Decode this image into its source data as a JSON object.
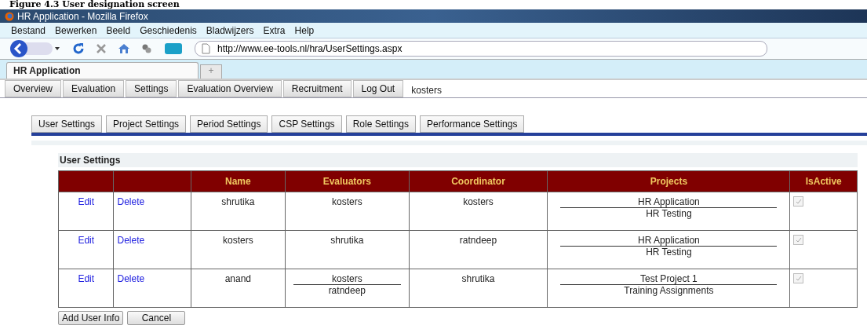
{
  "caption": "Figure 4.3 User designation screen",
  "window": {
    "title": "HR Application - Mozilla Firefox"
  },
  "menu": [
    "Bestand",
    "Bewerken",
    "Beeld",
    "Geschiedenis",
    "Bladwijzers",
    "Extra",
    "Help"
  ],
  "address": "http://www.ee-tools.nl/hra/UserSettings.aspx",
  "browser_tabs": [
    {
      "label": "HR Application",
      "selected": true
    }
  ],
  "new_tab": "+",
  "app_nav": [
    "Overview",
    "Evaluation",
    "Settings",
    "Evaluation Overview",
    "Recruitment",
    "Log Out"
  ],
  "user": "kosters",
  "settings_tabs": [
    {
      "label": "User Settings"
    },
    {
      "label": "Project Settings"
    },
    {
      "label": "Period Settings"
    },
    {
      "label": "CSP Settings"
    },
    {
      "label": "Role Settings"
    },
    {
      "label": "Performance Settings"
    }
  ],
  "section_title": "User Settings",
  "table": {
    "columns": [
      "",
      "",
      "Name",
      "Evaluators",
      "Coordinator",
      "Projects",
      "IsActive"
    ],
    "rows": [
      {
        "edit": "Edit",
        "delete": "Delete",
        "name": "shrutika",
        "evaluators": [
          "kosters"
        ],
        "coordinator": "kosters",
        "projects": [
          "HR Application",
          "HR Testing"
        ],
        "active": true
      },
      {
        "edit": "Edit",
        "delete": "Delete",
        "name": "kosters",
        "evaluators": [
          "shrutika"
        ],
        "coordinator": "ratndeep",
        "projects": [
          "HR Application",
          "HR Testing"
        ],
        "active": true
      },
      {
        "edit": "Edit",
        "delete": "Delete",
        "name": "anand",
        "evaluators": [
          "kosters",
          "ratndeep"
        ],
        "coordinator": "shrutika",
        "projects": [
          "Test Project 1",
          "Training Assignments"
        ],
        "active": true
      }
    ]
  },
  "buttons": [
    "Add User Info",
    "Cancel"
  ]
}
